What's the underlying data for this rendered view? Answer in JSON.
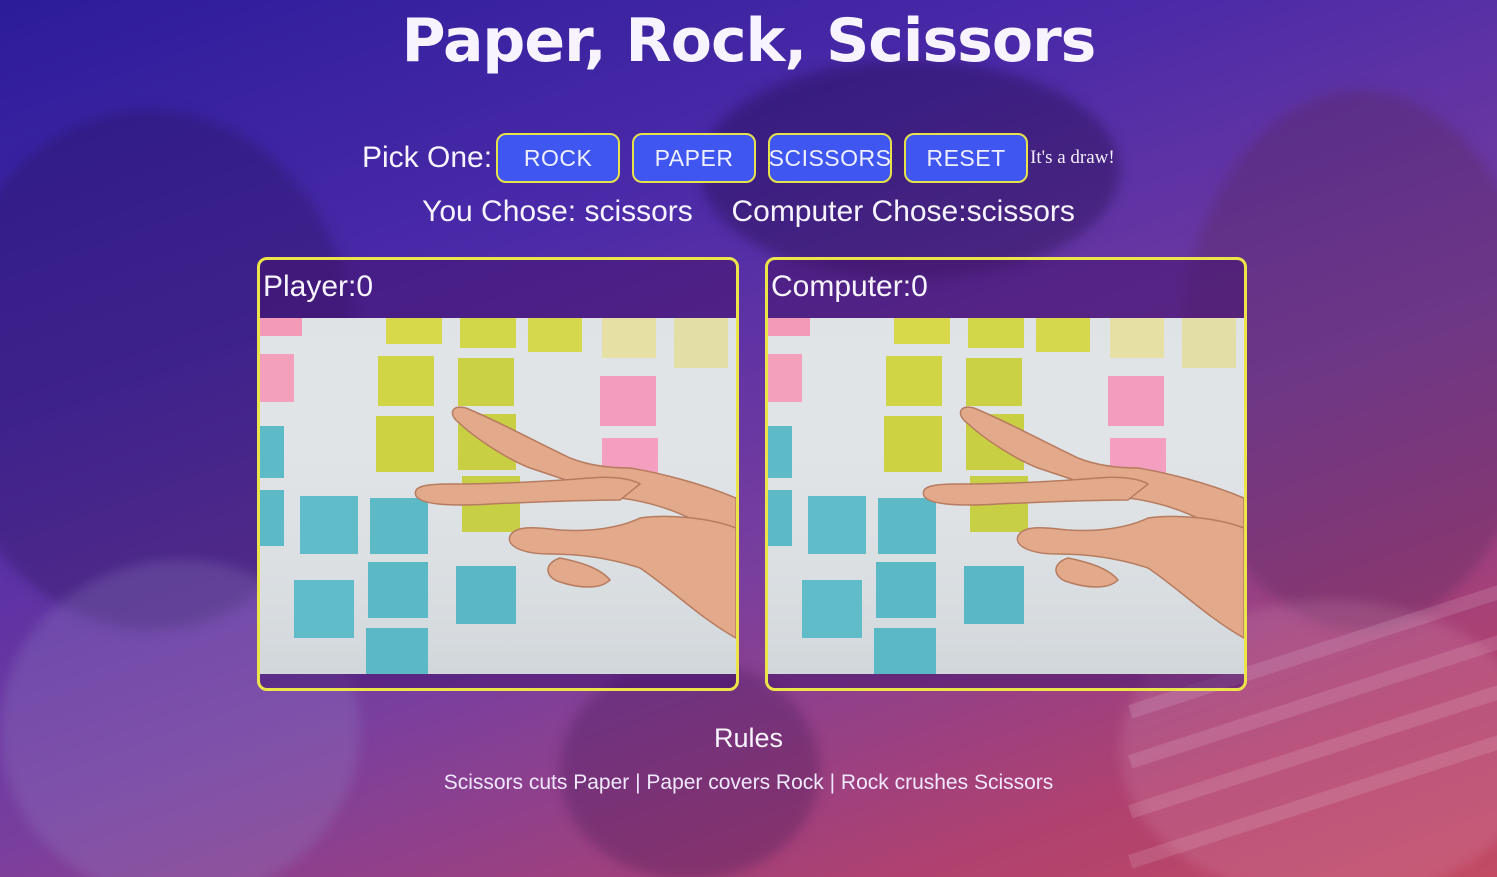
{
  "page": {
    "title": "Paper, Rock, Scissors"
  },
  "controls": {
    "pick_label": "Pick One:",
    "buttons": [
      {
        "label": "ROCK"
      },
      {
        "label": "PAPER"
      },
      {
        "label": "SCISSORS"
      },
      {
        "label": "RESET"
      }
    ],
    "result": "It's a draw!"
  },
  "choices": {
    "you_label": "You Chose:",
    "you_value": "scissors",
    "computer_label": "Computer Chose:",
    "computer_value": "scissors"
  },
  "panels": {
    "player": {
      "label": "Player:",
      "score": "0",
      "image_icon": "scissors-hand-image"
    },
    "computer": {
      "label": "Computer:",
      "score": "0",
      "image_icon": "scissors-hand-image"
    }
  },
  "rules": {
    "title": "Rules",
    "text": "Scissors cuts Paper | Paper covers Rock | Rock crushes Scissors"
  },
  "colors": {
    "button_bg": "#3f56f0",
    "button_border": "#e7e24a",
    "panel_border": "#ece54a",
    "gradient_start": "#2c1c9a",
    "gradient_end": "#c24a63"
  }
}
